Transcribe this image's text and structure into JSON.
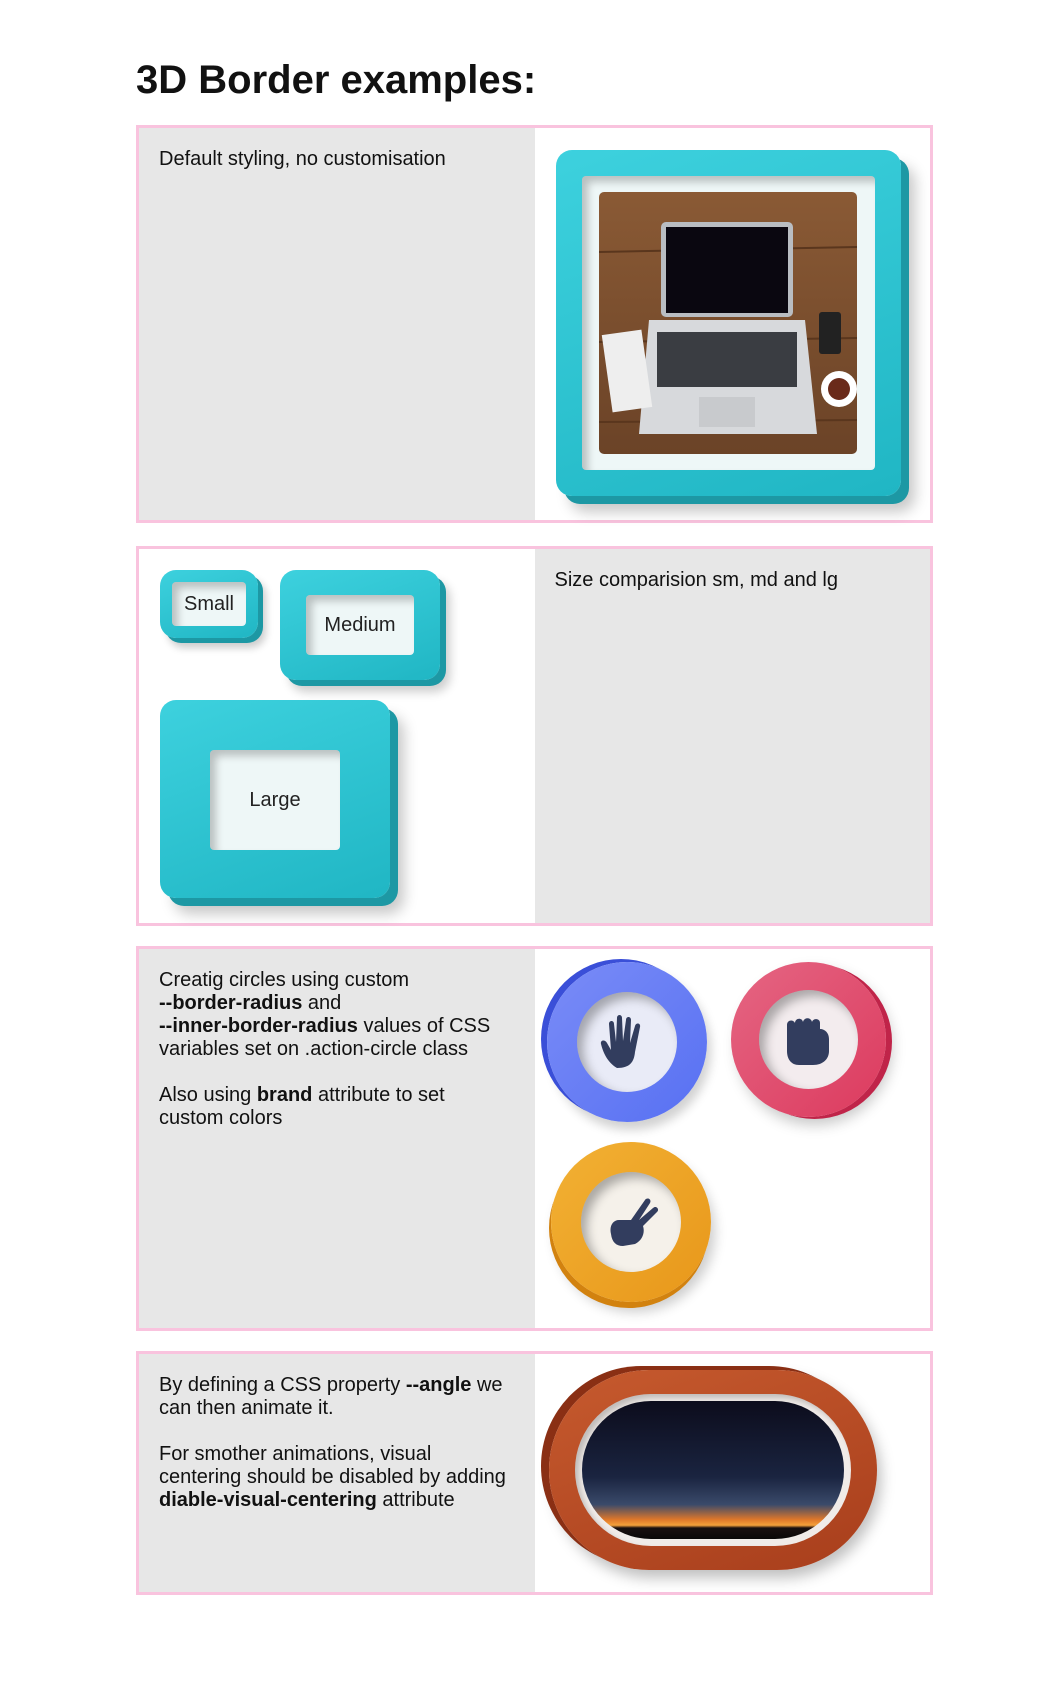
{
  "page": {
    "title": "3D Border examples:"
  },
  "section1": {
    "description": "Default styling, no customisation"
  },
  "section2": {
    "labels": {
      "small": "Small",
      "medium": "Medium",
      "large": "Large"
    },
    "description": "Size comparision sm, md and lg"
  },
  "section3": {
    "line1_pre": "Creatig circles using custom",
    "var1": "--border-radius",
    "line2_mid": "and",
    "var2": "--inner-border-radius",
    "line3_post": "values of CSS variables set on .action-circle class",
    "p2_pre": "Also using",
    "p2_bold": "brand",
    "p2_post": "attribute to set custom colors",
    "circles": [
      {
        "icon": "open-hand-icon",
        "color": "#5770f2"
      },
      {
        "icon": "fist-icon",
        "color": "#dc3a5e"
      },
      {
        "icon": "peace-hand-icon",
        "color": "#eea21f"
      }
    ]
  },
  "section4": {
    "p1_pre": "By defining a CSS property",
    "p1_bold": "--angle",
    "p1_post": "we can then animate it.",
    "p2_pre": "For smother animations, visual centering should be disabled by adding",
    "p2_bold": "diable-visual-centering",
    "p2_post": "attribute",
    "frame_color": "#b84a24"
  },
  "colors": {
    "teal": "#2cc3d1",
    "section_border": "#f9c3de",
    "panel_gray": "#e7e7e7"
  }
}
